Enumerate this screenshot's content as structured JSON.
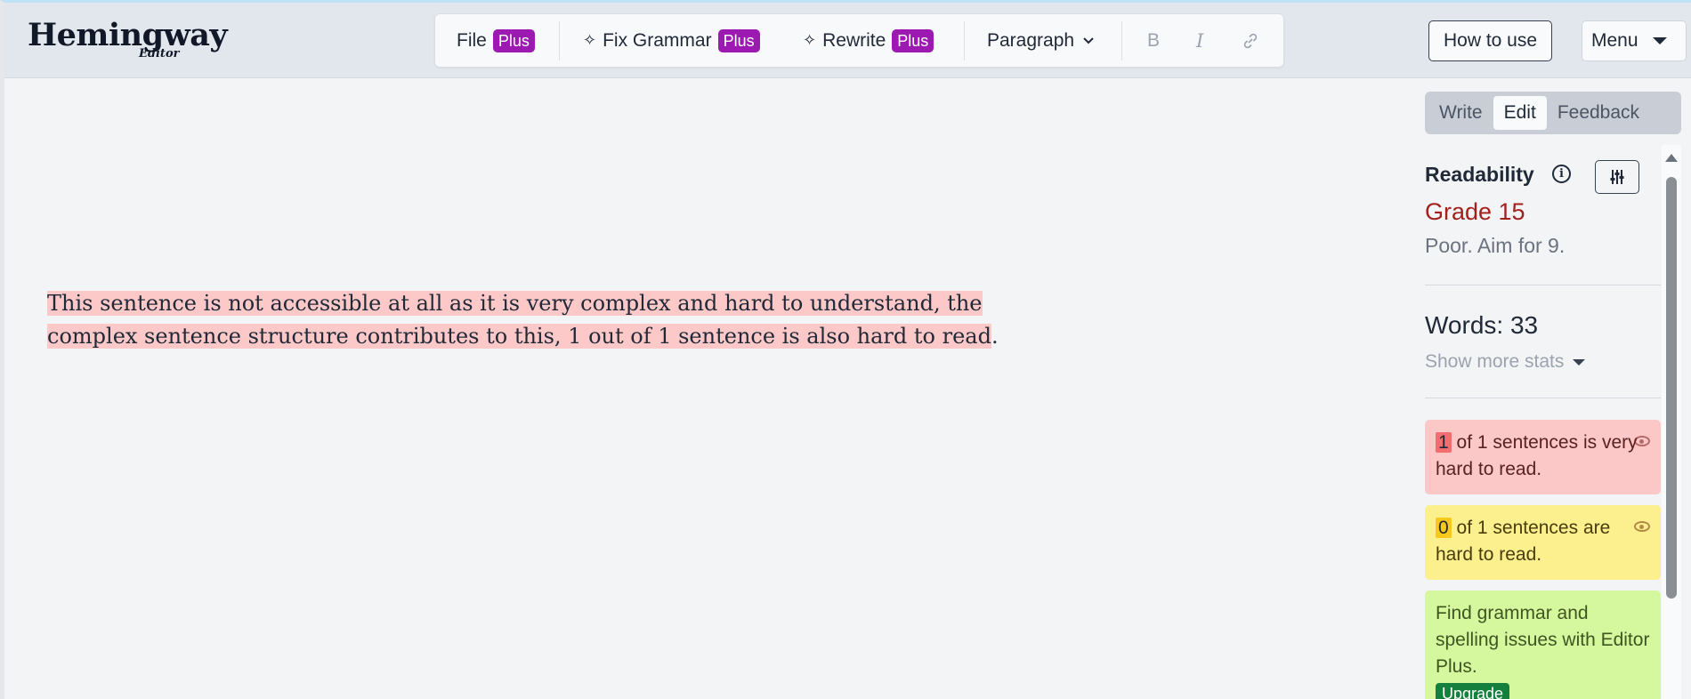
{
  "header": {
    "logo_main": "Hemingway",
    "logo_sub": "Editor",
    "toolbar": {
      "file_label": "File",
      "fix_grammar_label": "Fix Grammar",
      "rewrite_label": "Rewrite",
      "plus_badge": "Plus",
      "paragraph_label": "Paragraph",
      "bold_label": "B",
      "italic_label": "I"
    },
    "how_to_use_label": "How to use",
    "menu_label": "Menu"
  },
  "editor": {
    "highlighted_text": "This sentence is not accessible at all as it is very complex and hard to understand, the complex sentence structure contributes to this, 1 out of 1 sentence is also hard to read",
    "trailing_text": ".",
    "highlight_color": "#fcc8c8"
  },
  "sidebar": {
    "tabs": [
      {
        "label": "Write",
        "active": false
      },
      {
        "label": "Edit",
        "active": true
      },
      {
        "label": "Feedback",
        "active": false
      }
    ],
    "readability_title": "Readability",
    "grade": "Grade 15",
    "grade_note": "Poor. Aim for 9.",
    "words": "Words: 33",
    "show_more_stats": "Show more stats",
    "cards": {
      "very_hard": {
        "count": "1",
        "text": " of 1 sentences is very hard to read.",
        "color": "#fbc7c7"
      },
      "hard": {
        "count": "0",
        "text": " of 1 sentences are hard to read.",
        "color": "#fcef8e"
      },
      "grammar": {
        "text": "Find grammar and spelling issues with Editor Plus.",
        "upgrade_label": "Upgrade",
        "color": "#d5f79d"
      }
    }
  }
}
